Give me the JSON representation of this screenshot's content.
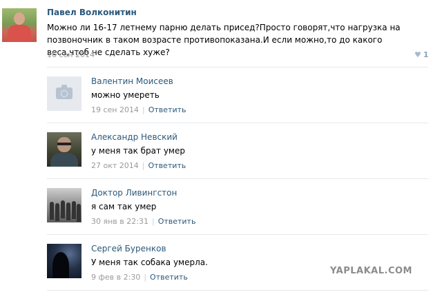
{
  "post": {
    "author": "Павел Волконитин",
    "text": "Можно ли 16-17 летнему парню делать присед?Просто говорят,что нагрузка на позвоночник в таком возрасте противопоказана.И если можно,то до какого веса,чтоб не сделать хуже?",
    "date": "16 сен 2014",
    "likes": "1"
  },
  "replies": [
    {
      "author": "Валентин Моисеев",
      "text": "можно умереть",
      "date": "19 сен 2014",
      "action": "Ответить"
    },
    {
      "author": "Александр Невский",
      "text": "у меня так брат умер",
      "date": "27 окт 2014",
      "action": "Ответить"
    },
    {
      "author": "Доктор Ливингстон",
      "text": "я сам так умер",
      "date": "30 янв в 22:31",
      "action": "Ответить"
    },
    {
      "author": "Сергей Буренков",
      "text": "У меня так собака умерла.",
      "date": "9 фев в 2:30",
      "action": "Ответить"
    }
  ],
  "watermark": "YAPLAKAL.COM"
}
